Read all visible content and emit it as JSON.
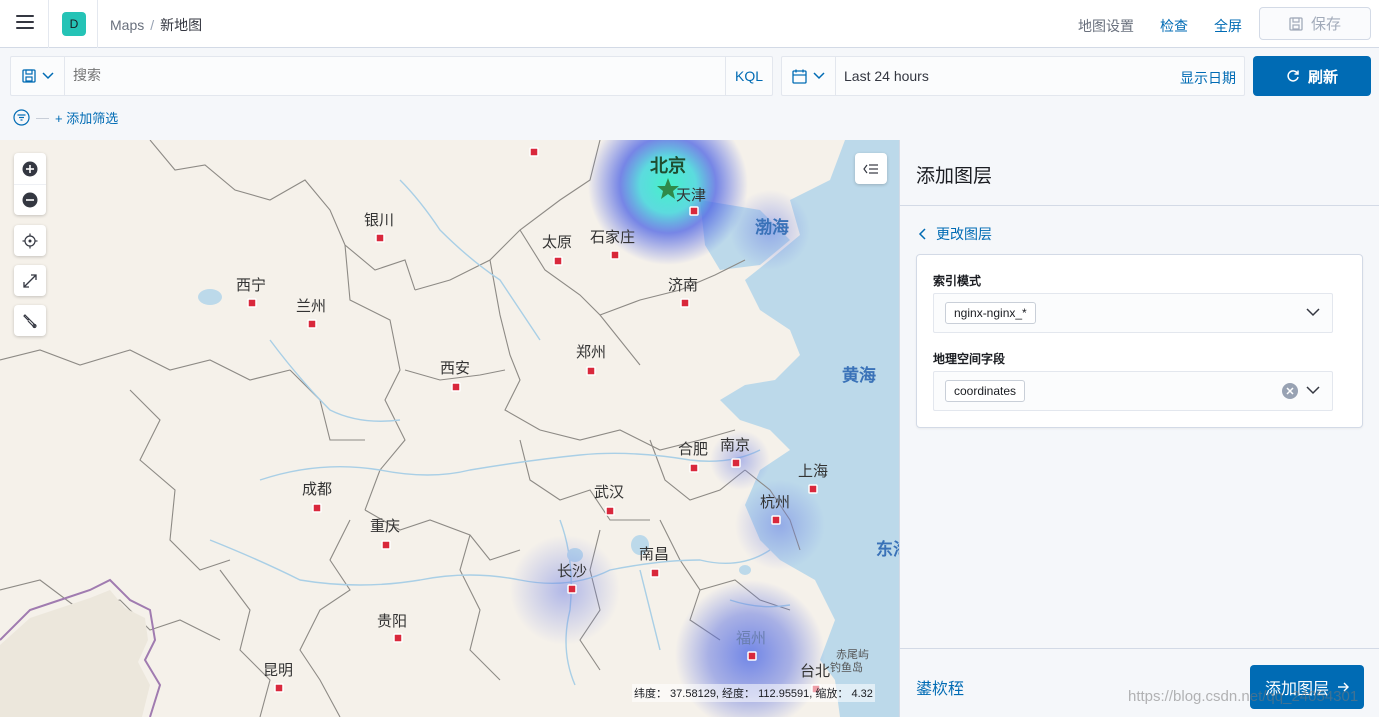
{
  "header": {
    "space_initial": "D",
    "breadcrumb_app": "Maps",
    "breadcrumb_sep": "/",
    "breadcrumb_page": "新地图",
    "map_settings": "地图设置",
    "inspect": "检查",
    "fullscreen": "全屏",
    "save": "保存"
  },
  "query": {
    "search_placeholder": "搜索",
    "kql": "KQL",
    "time_range": "Last 24 hours",
    "show_dates": "显示日期",
    "refresh": "刷新",
    "add_filter": "+ 添加筛选"
  },
  "map": {
    "seas": [
      "渤海",
      "黄海",
      "东海"
    ],
    "cities": [
      "北京",
      "天津",
      "石家庄",
      "太原",
      "银川",
      "西宁",
      "兰州",
      "济南",
      "郑州",
      "西安",
      "合肥",
      "南京",
      "上海",
      "杭州",
      "武汉",
      "成都",
      "重庆",
      "长沙",
      "南昌",
      "福州",
      "台北",
      "贵阳",
      "昆明"
    ],
    "minor_labels": [
      "赤尾屿",
      "钓鱼岛"
    ],
    "coords_readout": "纬度： 37.58129, 经度： 112.95591, 缩放： 4.32",
    "heat_colors": {
      "low": "#5b6ee0",
      "high": "#3cf2c8"
    }
  },
  "panel": {
    "title": "添加图层",
    "back": "更改图层",
    "index_label": "索引模式",
    "index_value": "nginx-nginx_*",
    "geo_label": "地理空间字段",
    "geo_value": "coordinates",
    "cancel": "鍙栨秷",
    "add_layer": "添加图层"
  },
  "watermark": "https://blog.csdn.net/qq_24054301",
  "colors": {
    "primary": "#006bb4",
    "avatar": "#25c3b6"
  }
}
